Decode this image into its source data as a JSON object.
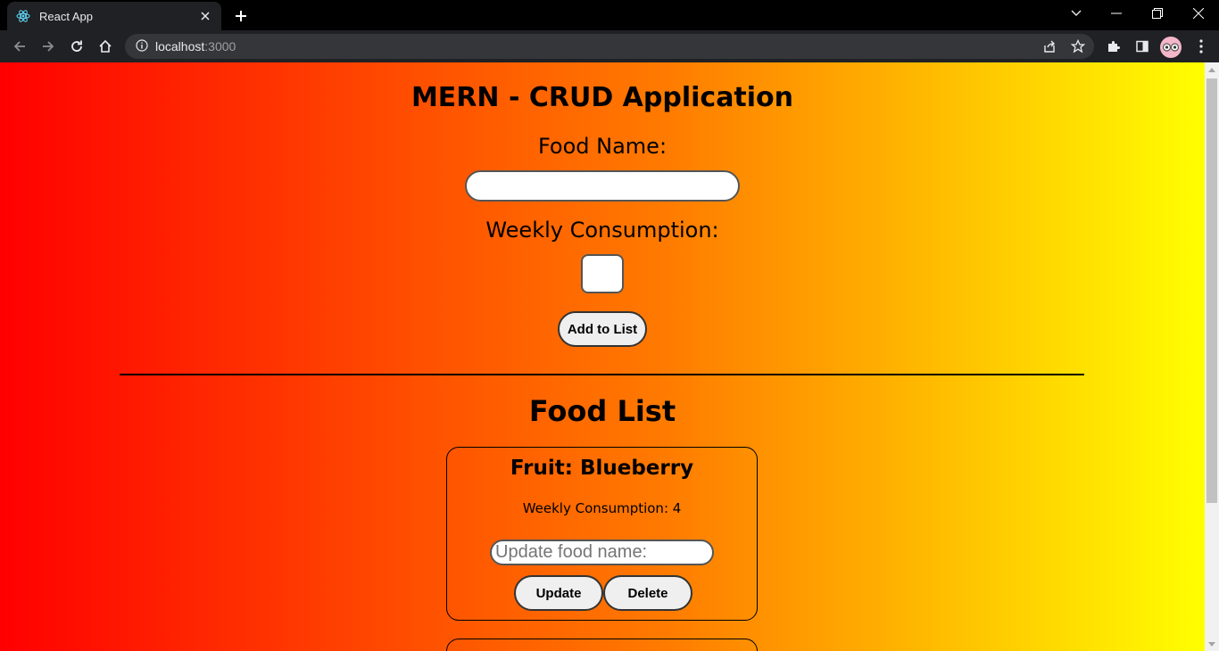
{
  "browser": {
    "tab_title": "React App",
    "url_host": "localhost",
    "url_port": ":3000"
  },
  "page": {
    "app_title": "MERN - CRUD Application",
    "food_name_label": "Food Name:",
    "food_name_value": "",
    "weekly_label": "Weekly Consumption:",
    "weekly_value": "",
    "add_button": "Add to List",
    "list_title": "Food List"
  },
  "food_items": [
    {
      "title": "Fruit: Blueberry",
      "consumption": "Weekly Consumption: 4",
      "update_placeholder": "Update food name:",
      "update_label": "Update",
      "delete_label": "Delete"
    }
  ],
  "colors": {
    "gradient_start": "#ff0000",
    "gradient_end": "#ffff00",
    "chrome_dark": "#202124"
  }
}
